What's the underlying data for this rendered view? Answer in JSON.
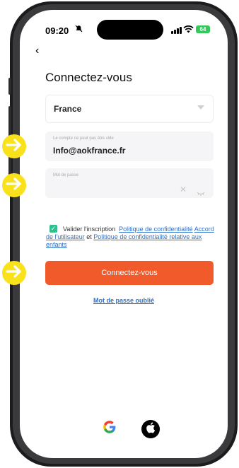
{
  "status_bar": {
    "time": "09:20",
    "battery": "64"
  },
  "header": {
    "title": "Connectez-vous"
  },
  "form": {
    "country": "France",
    "account_label": "Le compte ne peut pas être vide",
    "account_value": "Info@aokfrance.fr",
    "password_label": "Mot de passe"
  },
  "consent": {
    "text_before": "Valider l'inscription",
    "privacy_link_1": "Politique de confidentialité",
    "user_agreement_link": "Accord de l'utilisateur",
    "and_text": "et",
    "privacy_link_2": "Politique de confidentialité relative aux enfants",
    "checked": true
  },
  "actions": {
    "login_button": "Connectez-vous",
    "forgot_password": "Mot de passe oublié"
  },
  "social": {
    "google": "G"
  },
  "colors": {
    "accent": "#f15a2b",
    "link": "#2f6fc7",
    "checkbox": "#2fbf8f",
    "marker": "#f9e21b"
  }
}
